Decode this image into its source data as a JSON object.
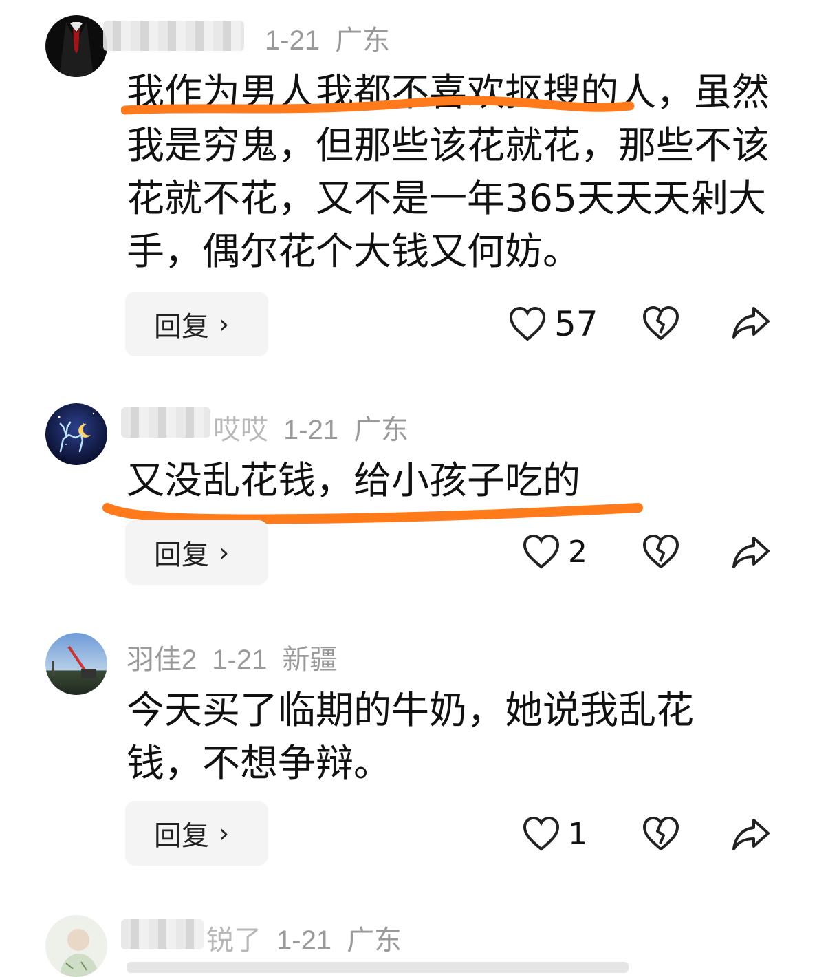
{
  "comments": [
    {
      "username": "",
      "date": "1-21",
      "location": "广东",
      "text": "我作为男人我都不喜欢抠搜的人，虽然我是穷鬼，但那些该花就花，那些不该花就不花，又不是一年365天天天剁大手，偶尔花个大钱又何妨。",
      "reply_label": "回复",
      "likes": "57"
    },
    {
      "username": "",
      "username_visible_suffix": "哎哎",
      "date": "1-21",
      "location": "广东",
      "text": "又没乱花钱，给小孩子吃的",
      "reply_label": "回复",
      "likes": "2"
    },
    {
      "username": "羽佳2",
      "date": "1-21",
      "location": "新疆",
      "text": "今天买了临期的牛奶，她说我乱花钱，不想争辩。",
      "reply_label": "回复",
      "likes": "1"
    },
    {
      "username": "",
      "username_visible_suffix": "锐了",
      "date": "1-21",
      "location": "广东"
    }
  ],
  "icons": {
    "like": "heart-outline-icon",
    "dislike": "broken-heart-icon",
    "share": "share-arrow-icon",
    "chevron": "chevron-right-icon"
  },
  "colors": {
    "highlight": "#ff7a1a",
    "meta": "#9a9a9a",
    "text": "#111111",
    "reply_bg": "#f4f4f4"
  }
}
